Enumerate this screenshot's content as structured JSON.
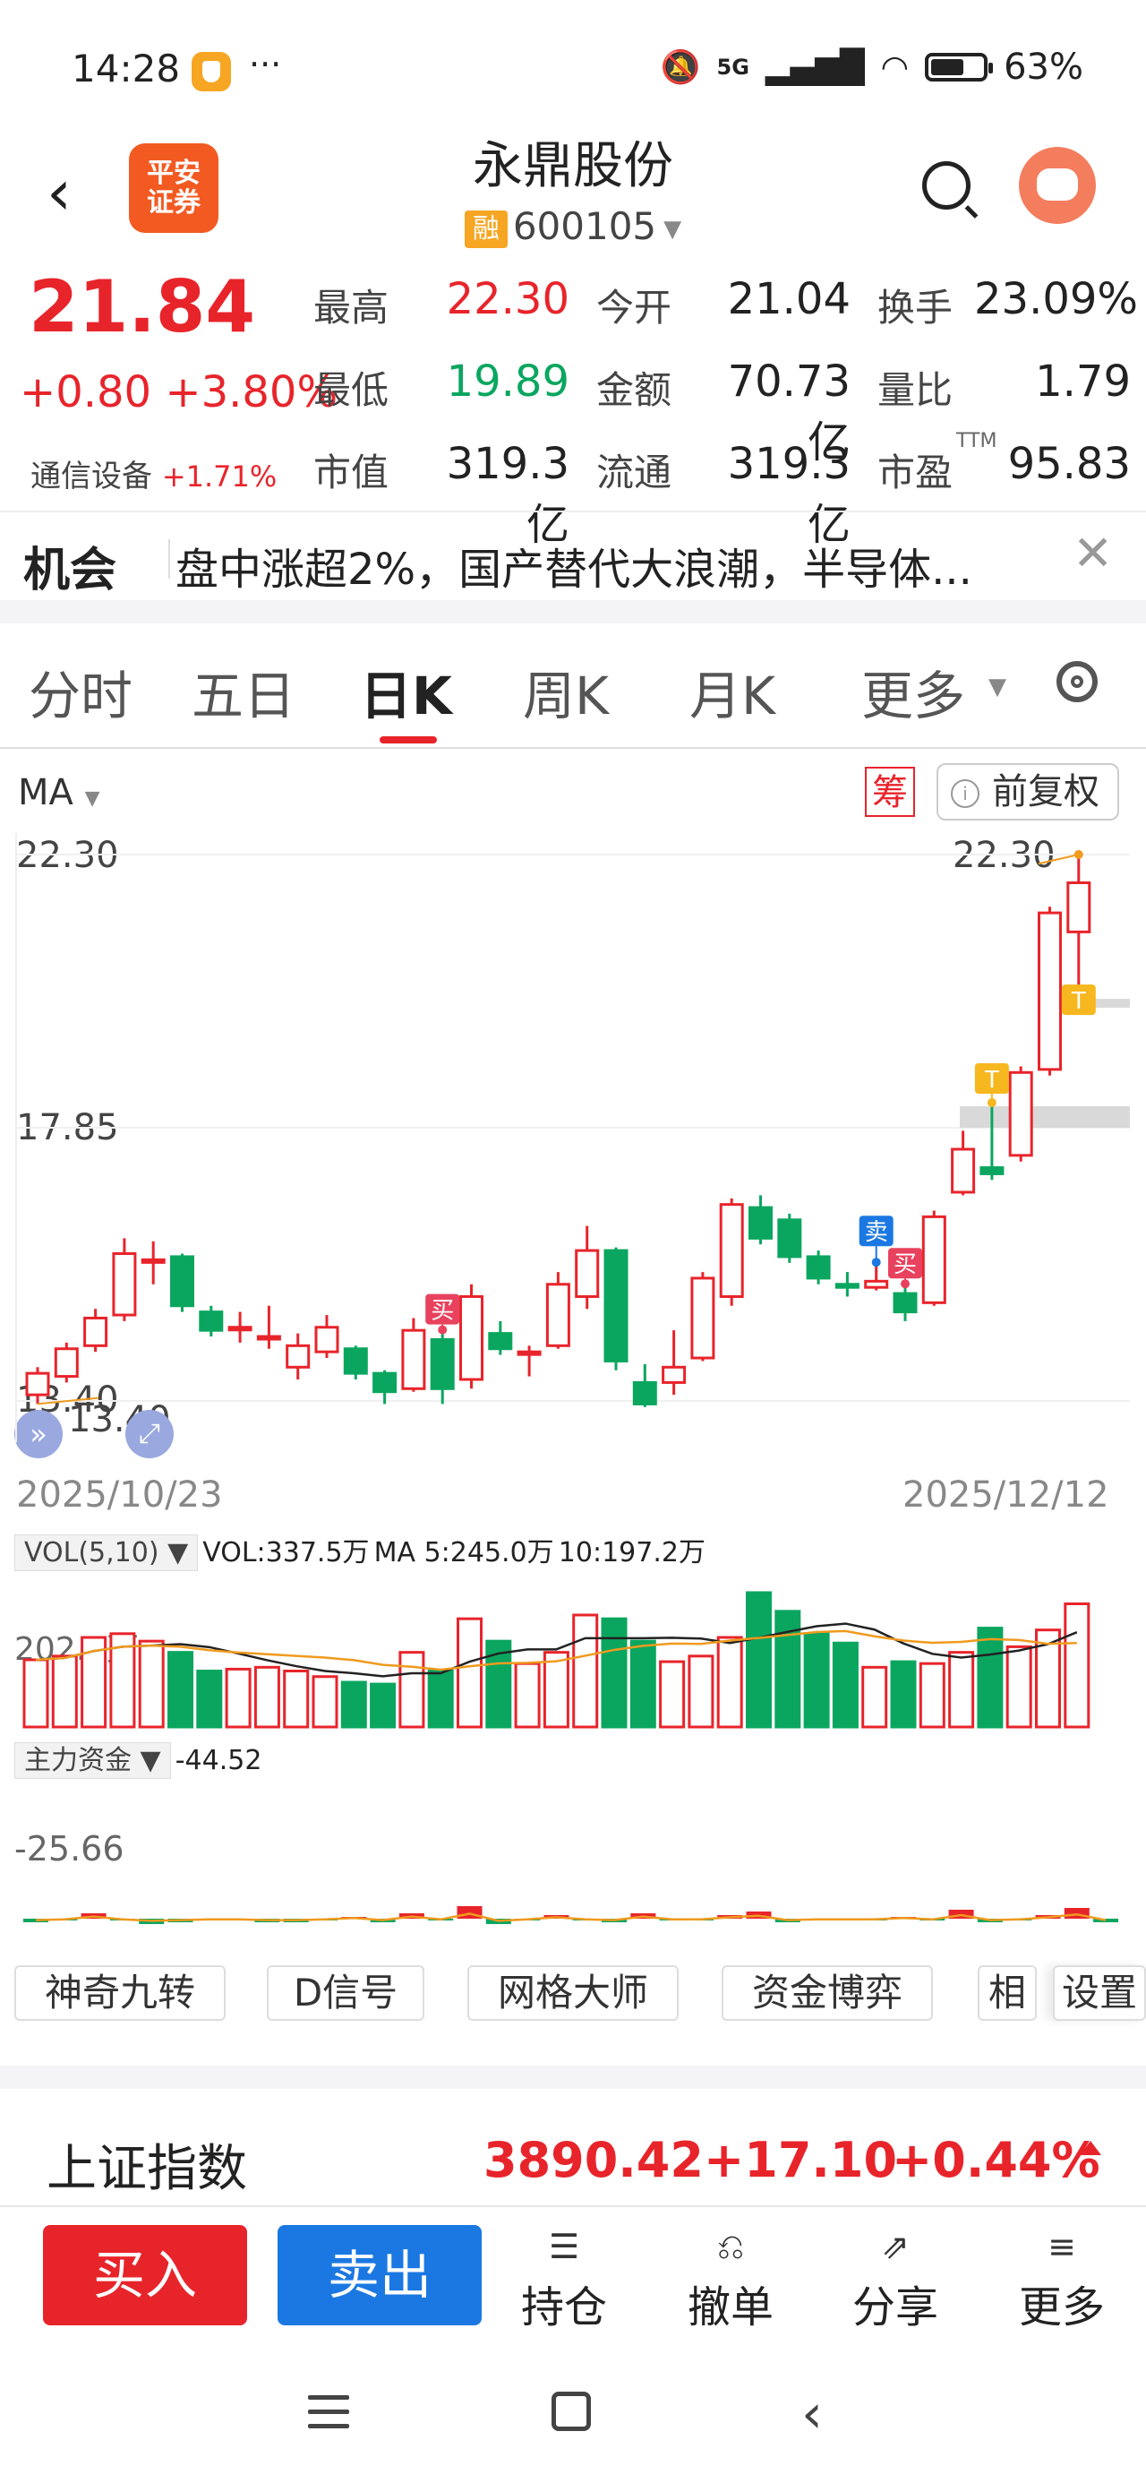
{
  "status_bar": {
    "time": "14:28",
    "dots": "···",
    "network": "5G",
    "battery": "63%"
  },
  "header": {
    "logo_line1": "平安",
    "logo_line2": "证券",
    "name": "永鼎股份",
    "badge": "融",
    "code": "600105"
  },
  "quote": {
    "price": "21.84",
    "change": "+0.80 +3.80%",
    "sector": "通信设备",
    "sector_change": "+1.71%",
    "rows": [
      [
        {
          "label": "最高",
          "value": "22.30",
          "color": "red"
        },
        {
          "label": "今开",
          "value": "21.04",
          "color": "black"
        },
        {
          "label": "换手",
          "value": "23.09%",
          "color": "black"
        }
      ],
      [
        {
          "label": "最低",
          "value": "19.89",
          "color": "green"
        },
        {
          "label": "金额",
          "value": "70.73亿",
          "color": "black"
        },
        {
          "label": "量比",
          "value": "1.79",
          "color": "black"
        }
      ],
      [
        {
          "label": "市值",
          "value": "319.3亿",
          "color": "black"
        },
        {
          "label": "流通",
          "value": "319.3亿",
          "color": "black"
        },
        {
          "label": "市盈",
          "value": "95.83",
          "color": "black",
          "sup": "TTM"
        }
      ]
    ]
  },
  "opportunity": {
    "title": "机会",
    "text": "盘中涨超2%，国产替代大浪潮，半导体..."
  },
  "tabs": [
    "分时",
    "五日",
    "日K",
    "周K",
    "月K",
    "更多"
  ],
  "active_tab": "日K",
  "chart_controls": {
    "ma_label": "MA",
    "chou": "筹",
    "fuquan": "前复权"
  },
  "chart_data": {
    "type": "candlestick",
    "y_labels": [
      "22.30",
      "17.85",
      "13.40"
    ],
    "high_label": "22.30",
    "low_label": "13.40",
    "date_start": "2025/10/23",
    "date_end": "2025/12/12",
    "candles": [
      {
        "o": 13.5,
        "c": 13.85,
        "h": 13.95,
        "l": 13.35
      },
      {
        "o": 13.8,
        "c": 14.25,
        "h": 14.35,
        "l": 13.7
      },
      {
        "o": 14.3,
        "c": 14.75,
        "h": 14.9,
        "l": 14.2
      },
      {
        "o": 14.8,
        "c": 15.8,
        "h": 16.05,
        "l": 14.7
      },
      {
        "o": 15.7,
        "c": 15.7,
        "h": 16.0,
        "l": 15.3
      },
      {
        "o": 15.75,
        "c": 14.95,
        "h": 15.8,
        "l": 14.85
      },
      {
        "o": 14.85,
        "c": 14.55,
        "h": 14.95,
        "l": 14.45
      },
      {
        "o": 14.6,
        "c": 14.6,
        "h": 14.85,
        "l": 14.35
      },
      {
        "o": 14.45,
        "c": 14.45,
        "h": 14.95,
        "l": 14.25
      },
      {
        "o": 13.95,
        "c": 14.3,
        "h": 14.5,
        "l": 13.75
      },
      {
        "o": 14.2,
        "c": 14.6,
        "h": 14.8,
        "l": 14.1
      },
      {
        "o": 14.25,
        "c": 13.85,
        "h": 14.3,
        "l": 13.75
      },
      {
        "o": 13.85,
        "c": 13.55,
        "h": 13.9,
        "l": 13.35
      },
      {
        "o": 13.6,
        "c": 14.55,
        "h": 14.75,
        "l": 13.55
      },
      {
        "o": 14.4,
        "c": 13.6,
        "h": 14.5,
        "l": 13.35
      },
      {
        "o": 13.75,
        "c": 15.1,
        "h": 15.3,
        "l": 13.6
      },
      {
        "o": 14.5,
        "c": 14.25,
        "h": 14.7,
        "l": 14.15
      },
      {
        "o": 14.2,
        "c": 14.2,
        "h": 14.3,
        "l": 13.8
      },
      {
        "o": 14.3,
        "c": 15.3,
        "h": 15.5,
        "l": 14.25
      },
      {
        "o": 15.1,
        "c": 15.85,
        "h": 16.25,
        "l": 14.9
      },
      {
        "o": 15.85,
        "c": 14.05,
        "h": 15.9,
        "l": 13.9
      },
      {
        "o": 13.7,
        "c": 13.35,
        "h": 14.0,
        "l": 13.3
      },
      {
        "o": 13.7,
        "c": 13.95,
        "h": 14.55,
        "l": 13.5
      },
      {
        "o": 14.1,
        "c": 15.4,
        "h": 15.5,
        "l": 14.05
      },
      {
        "o": 15.1,
        "c": 16.6,
        "h": 16.7,
        "l": 14.95
      },
      {
        "o": 16.55,
        "c": 16.05,
        "h": 16.75,
        "l": 15.95
      },
      {
        "o": 16.35,
        "c": 15.75,
        "h": 16.45,
        "l": 15.65
      },
      {
        "o": 15.75,
        "c": 15.4,
        "h": 15.85,
        "l": 15.3
      },
      {
        "o": 15.3,
        "c": 15.25,
        "h": 15.5,
        "l": 15.1
      },
      {
        "o": 15.25,
        "c": 15.35,
        "h": 15.6,
        "l": 15.2
      },
      {
        "o": 15.15,
        "c": 14.85,
        "h": 15.25,
        "l": 14.7
      },
      {
        "o": 15.0,
        "c": 16.4,
        "h": 16.5,
        "l": 14.95
      },
      {
        "o": 16.8,
        "c": 17.5,
        "h": 17.8,
        "l": 16.75
      },
      {
        "o": 17.2,
        "c": 17.1,
        "h": 18.2,
        "l": 17.0
      },
      {
        "o": 17.4,
        "c": 18.75,
        "h": 18.85,
        "l": 17.3
      },
      {
        "o": 18.8,
        "c": 21.35,
        "h": 21.45,
        "l": 18.7
      },
      {
        "o": 21.04,
        "c": 21.84,
        "h": 22.3,
        "l": 19.89
      }
    ],
    "markers": [
      {
        "text": "买",
        "index": 14
      },
      {
        "text": "卖",
        "index": 29
      },
      {
        "text": "买",
        "index": 30
      },
      {
        "text": "T",
        "index": 33
      },
      {
        "text": "T",
        "index": 36
      }
    ]
  },
  "volume": {
    "label": "VOL(5,10)",
    "summary_vol": "VOL:337.5万",
    "summary_ma5": "MA 5:245.0万",
    "summary_ma10": "10:197.2万",
    "axis_label": "202.5万",
    "values": [
      180,
      190,
      240,
      250,
      230,
      200,
      150,
      155,
      160,
      150,
      135,
      120,
      115,
      200,
      150,
      290,
      230,
      170,
      200,
      300,
      290,
      230,
      175,
      190,
      240,
      360,
      310,
      250,
      225,
      160,
      175,
      170,
      200,
      265,
      215,
      260,
      330
    ]
  },
  "fund": {
    "label": "主力资金",
    "value": "-44.52",
    "axis_label": "-25.66",
    "values": [
      -2,
      -1,
      3,
      -1,
      -3,
      -2,
      -1,
      -1,
      -2,
      -2,
      -1,
      1,
      -2,
      3,
      -1,
      7,
      -3,
      -1,
      2,
      -1,
      -2,
      3,
      -1,
      -1,
      2,
      4,
      -2,
      -1,
      -1,
      -1,
      1,
      -1,
      5,
      -2,
      -1,
      2,
      6,
      -2
    ]
  },
  "tools": [
    "神奇九转",
    "D信号",
    "网格大师",
    "资金博弈",
    "相",
    "设置"
  ],
  "index_bar": {
    "name": "上证指数",
    "value": "3890.42",
    "change": "+17.10",
    "pct": "+0.44%"
  },
  "actions": {
    "buy": "买入",
    "sell": "卖出",
    "items": [
      {
        "label": "持仓",
        "icon": "list-icon"
      },
      {
        "label": "撤单",
        "icon": "undo-icon"
      },
      {
        "label": "分享",
        "icon": "share-icon"
      },
      {
        "label": "更多",
        "icon": "more-icon"
      }
    ]
  },
  "colors": {
    "up": "#e8242b",
    "down": "#0aa65f",
    "ma5": "#222222",
    "ma10": "#f09a1e",
    "buy_marker": "#e8425e",
    "sell_marker": "#1b78e2",
    "t_marker": "#f6b71f"
  }
}
